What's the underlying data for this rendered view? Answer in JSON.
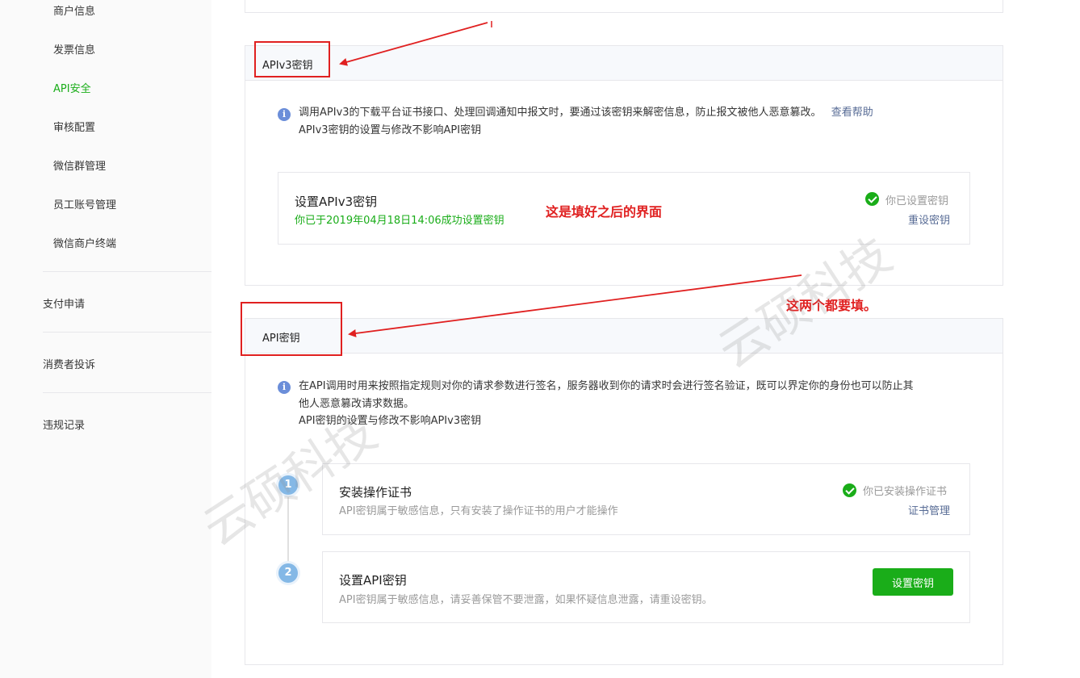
{
  "sidebar": {
    "sub_items": [
      {
        "label": "商户信息"
      },
      {
        "label": "发票信息"
      },
      {
        "label": "API安全"
      },
      {
        "label": "审核配置"
      },
      {
        "label": "微信群管理"
      },
      {
        "label": "员工账号管理"
      },
      {
        "label": "微信商户终端"
      }
    ],
    "top_items": [
      {
        "label": "支付申请"
      },
      {
        "label": "消费者投诉"
      },
      {
        "label": "违规记录"
      }
    ]
  },
  "apiv3": {
    "title": "APIv3密钥",
    "info_line1": "调用APIv3的下载平台证书接口、处理回调通知中报文时，要通过该密钥来解密信息，防止报文被他人恶意篡改。",
    "help_link": "查看帮助",
    "info_line2": "APIv3密钥的设置与修改不影响API密钥",
    "card": {
      "title": "设置APIv3密钥",
      "subtitle": "你已于2019年04月18日14:06成功设置密钥",
      "status": "你已设置密钥",
      "action": "重设密钥"
    }
  },
  "api": {
    "title": "API密钥",
    "info_line1": "在API调用时用来按照指定规则对你的请求参数进行签名，服务器收到你的请求时会进行签名验证，既可以界定你的身份也可以防止其",
    "info_line2": "他人恶意篡改请求数据。",
    "info_line3": "API密钥的设置与修改不影响APIv3密钥",
    "steps": [
      {
        "num": "1",
        "title": "安装操作证书",
        "subtitle": "API密钥属于敏感信息，只有安装了操作证书的用户才能操作",
        "status": "你已安装操作证书",
        "action": "证书管理"
      },
      {
        "num": "2",
        "title": "设置API密钥",
        "subtitle": "API密钥属于敏感信息，请妥善保管不要泄露，如果怀疑信息泄露，请重设密钥。",
        "button": "设置密钥"
      }
    ]
  },
  "annotations": {
    "note1": "这是填好之后的界面",
    "note2": "这两个都要填。"
  },
  "watermark": {
    "text": "云硕科技"
  },
  "colors": {
    "accent_green": "#1aad19",
    "link_blue": "#576b95",
    "annotation_red": "#e02020"
  }
}
